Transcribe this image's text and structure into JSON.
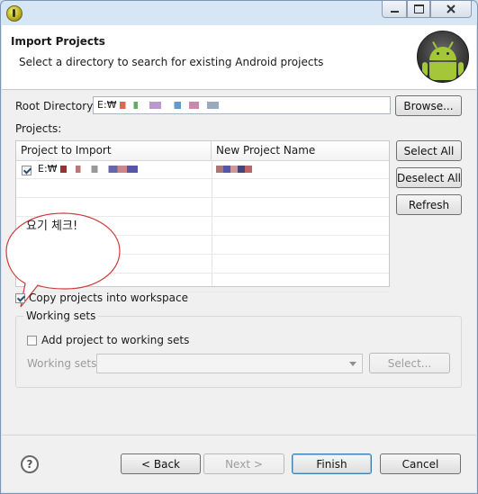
{
  "window": {
    "title_icon": "app-icon"
  },
  "header": {
    "title": "Import Projects",
    "description": "Select a directory to search for existing Android projects",
    "badge_icon": "android-icon"
  },
  "root": {
    "label": "Root Directory:",
    "value_visible": "E:₩",
    "browse_label": "Browse..."
  },
  "projects": {
    "label": "Projects:",
    "columns": [
      "Project to Import",
      "New Project Name"
    ],
    "rows": [
      {
        "checked": true,
        "project_prefix": "E:₩",
        "name": ""
      }
    ],
    "select_all": "Select All",
    "deselect_all": "Deselect All",
    "refresh": "Refresh"
  },
  "annotation": {
    "text": "요기 체크!"
  },
  "copy_projects": {
    "label": "Copy projects into workspace",
    "checked": true
  },
  "working_sets": {
    "group_label": "Working sets",
    "add_label": "Add project to working sets",
    "add_checked": false,
    "field_label": "Working sets:",
    "select_label": "Select..."
  },
  "footer": {
    "help_symbol": "?",
    "back": "< Back",
    "next": "Next >",
    "finish": "Finish",
    "cancel": "Cancel"
  }
}
